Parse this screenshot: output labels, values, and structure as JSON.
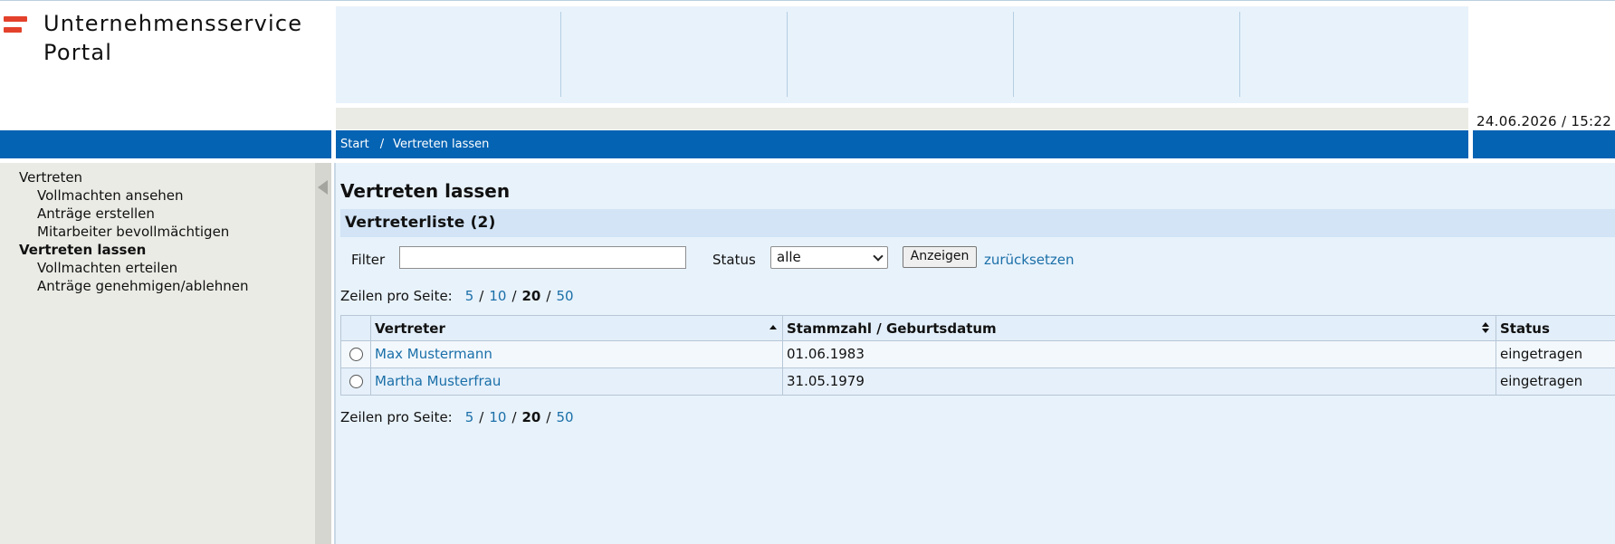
{
  "header": {
    "logo_line1": "Unternehmensservice",
    "logo_line2": "Portal",
    "datetime": "24.06.2026 / 15:22",
    "accent_color": "#0563b3",
    "flag_color": "#e3412b"
  },
  "breadcrumb": {
    "start": "Start",
    "separator": "/",
    "current": "Vertreten lassen"
  },
  "sidebar": {
    "items": [
      {
        "label": "Vertreten",
        "level": 0,
        "active": false
      },
      {
        "label": "Vollmachten ansehen",
        "level": 1,
        "active": false
      },
      {
        "label": "Anträge erstellen",
        "level": 1,
        "active": false
      },
      {
        "label": "Mitarbeiter bevollmächtigen",
        "level": 1,
        "active": false
      },
      {
        "label": "Vertreten lassen",
        "level": 0,
        "active": true
      },
      {
        "label": "Vollmachten erteilen",
        "level": 1,
        "active": false
      },
      {
        "label": "Anträge genehmigen/ablehnen",
        "level": 1,
        "active": false
      }
    ],
    "collapse_icon": "triangle-left-icon"
  },
  "main": {
    "title": "Vertreten lassen",
    "section_title": "Vertreterliste (2)",
    "filter": {
      "label": "Filter",
      "value": "",
      "status_label": "Status",
      "status_value": "alle",
      "show_button": "Anzeigen",
      "reset_link": "zurücksetzen"
    },
    "rows_per_page": {
      "label": "Zeilen pro Seite:",
      "options": [
        "5",
        "10",
        "20",
        "50"
      ],
      "current": "20",
      "separator": "/"
    },
    "table": {
      "columns": [
        "",
        "Vertreter",
        "Stammzahl / Geburtsdatum",
        "Status"
      ],
      "rows": [
        {
          "name": "Max Mustermann",
          "date": "01.06.1983",
          "status": "eingetragen"
        },
        {
          "name": "Martha Musterfrau",
          "date": "31.05.1979",
          "status": "eingetragen"
        }
      ]
    }
  }
}
